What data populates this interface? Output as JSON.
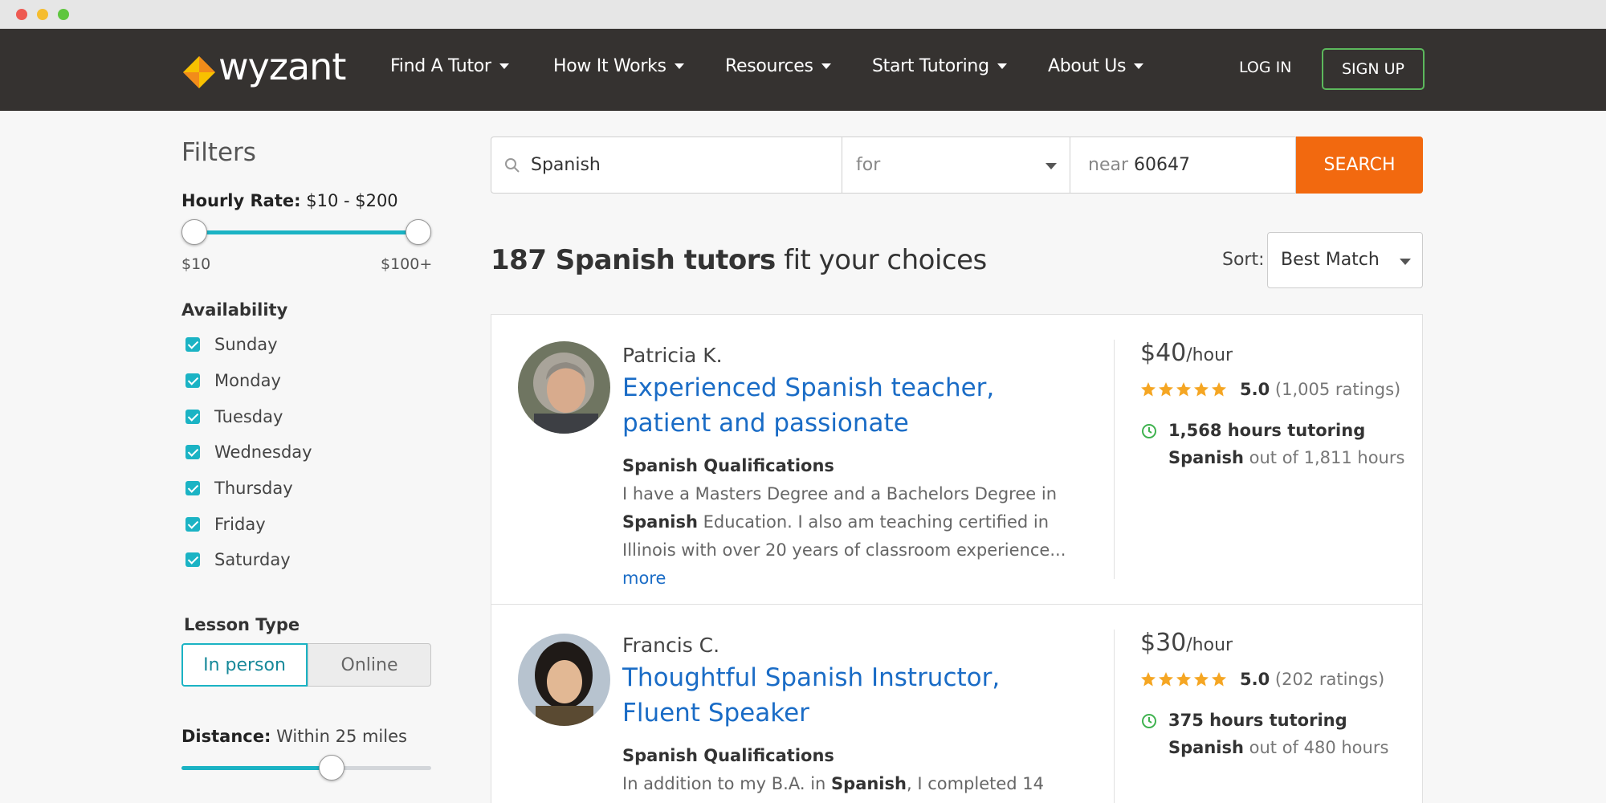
{
  "colors": {
    "accent": "#1bb3c4",
    "search_button": "#f2690f",
    "link": "#1a6cc6",
    "nav_bg": "#353230",
    "signup_border": "#5cb85c",
    "star": "#f5a623",
    "logo_yellow": "#f8c100",
    "logo_orange": "#f28c1a"
  },
  "brand": {
    "logo_text": "wyzant"
  },
  "nav": {
    "items": [
      {
        "label": "Find A Tutor"
      },
      {
        "label": "How It Works"
      },
      {
        "label": "Resources"
      },
      {
        "label": "Start Tutoring"
      },
      {
        "label": "About Us"
      }
    ],
    "login": "LOG IN",
    "signup": "SIGN UP"
  },
  "filters": {
    "title": "Filters",
    "hourly_rate": {
      "label": "Hourly Rate:",
      "value": "$10 - $200",
      "min_label": "$10",
      "max_label": "$100+"
    },
    "availability": {
      "title": "Availability",
      "days": [
        "Sunday",
        "Monday",
        "Tuesday",
        "Wednesday",
        "Thursday",
        "Friday",
        "Saturday"
      ]
    },
    "lesson_type": {
      "title": "Lesson Type",
      "options": [
        "In person",
        "Online"
      ],
      "selected": "In person"
    },
    "distance": {
      "label": "Distance:",
      "value": "Within 25 miles",
      "slider_fraction": 0.6
    }
  },
  "search": {
    "subject": "Spanish",
    "for_placeholder": "for",
    "near_label": "near",
    "zip": "60647",
    "button": "SEARCH"
  },
  "results": {
    "count_bold": "187 Spanish tutors",
    "count_rest": "fit your choices",
    "sort_label": "Sort:",
    "sort_value": "Best Match"
  },
  "tutors": [
    {
      "name": "Patricia K.",
      "title": "Experienced Spanish teacher, patient and passionate",
      "qual_title": "Spanish Qualifications",
      "desc_a": "I have a Masters Degree and a Bachelors Degree in",
      "desc_bold": "Spanish",
      "desc_b": "Education. I also am teaching certified in Illinois with over 20 years of classroom experience...",
      "more": "more",
      "price": "$40",
      "per": "/hour",
      "rating_value": "5.0",
      "rating_count": "(1,005 ratings)",
      "stars": 5,
      "hours_line": "1,568 hours tutoring",
      "hours_subject": "Spanish",
      "hours_total": "out of 1,811 hours"
    },
    {
      "name": "Francis C.",
      "title": "Thoughtful Spanish Instructor, Fluent Speaker",
      "qual_title": "Spanish Qualifications",
      "desc_a": "In addition to my B.A. in",
      "desc_bold": "Spanish",
      "desc_b": ", I completed 14",
      "price": "$30",
      "per": "/hour",
      "rating_value": "5.0",
      "rating_count": "(202 ratings)",
      "stars": 5,
      "hours_line": "375 hours tutoring",
      "hours_subject": "Spanish",
      "hours_total": "out of 480 hours"
    }
  ]
}
